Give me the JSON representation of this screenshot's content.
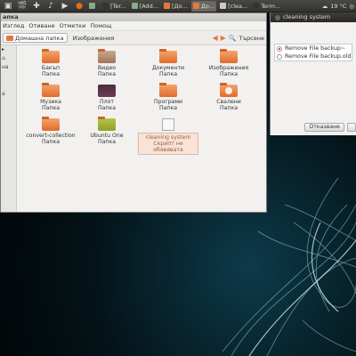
{
  "panel": {
    "tasks": [
      {
        "label": "",
        "active": false
      },
      {
        "label": "[Ter...",
        "active": false
      },
      {
        "label": "[Add...",
        "active": false
      },
      {
        "label": "[До...",
        "active": false
      },
      {
        "label": "До...",
        "active": true
      },
      {
        "label": "[clea...",
        "active": false
      },
      {
        "label": "Term...",
        "active": false
      }
    ],
    "temperature": "19 °C",
    "accent": "#e27a3f"
  },
  "nautilus": {
    "title": "апка",
    "menu": [
      "Изглед",
      "Отиване",
      "Отметки",
      "Помощ"
    ],
    "breadcrumbs": [
      "Домашна папка",
      "Изображения"
    ],
    "search_label": "Търсене",
    "sidebar": [
      "на",
      "а"
    ],
    "items": [
      {
        "name": "Бакъп",
        "sub": "Папка",
        "icon": "folder"
      },
      {
        "name": "Видео",
        "sub": "Папка",
        "icon": "folder-videos"
      },
      {
        "name": "Документи",
        "sub": "Папка",
        "icon": "folder"
      },
      {
        "name": "Изображения",
        "sub": "Папка",
        "icon": "folder"
      },
      {
        "name": "Музика",
        "sub": "Папка",
        "icon": "folder"
      },
      {
        "name": "Плот",
        "sub": "Папка",
        "icon": "folder-desktop"
      },
      {
        "name": "Програми",
        "sub": "Папка",
        "icon": "folder"
      },
      {
        "name": "Свалени",
        "sub": "Папка",
        "icon": "folder-downloads"
      },
      {
        "name": "convert-collection",
        "sub": "Папка",
        "icon": "folder"
      },
      {
        "name": "Ubuntu One",
        "sub": "Папка",
        "icon": "folder-ubuntu-one"
      },
      {
        "name": "cleaning system",
        "sub": "Скрипт не обявявата",
        "icon": "script-document",
        "selected": true
      }
    ]
  },
  "dialog": {
    "title": "cleaning system",
    "options": [
      {
        "label": "Remove File backup~",
        "checked": true
      },
      {
        "label": "Remove File backup.old",
        "checked": false
      }
    ],
    "cancel_label": "Отказване"
  }
}
